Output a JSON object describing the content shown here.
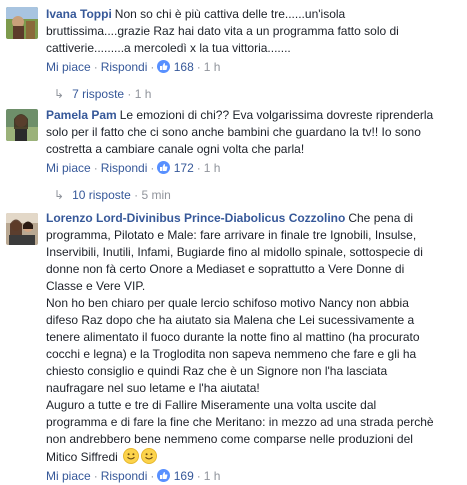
{
  "comments": [
    {
      "author": "Ivana Toppi",
      "text_lines": [
        "Non so chi è più cattiva delle tre......un'isola",
        "bruttissima....grazie Raz hai dato vita a un programma fatto solo di",
        "cattiverie.........a mercoledì x la tua vittoria......."
      ],
      "like_label": "Mi piace",
      "reply_label": "Rispondi",
      "like_count": "168",
      "time": "1 h",
      "replies_label": "7 risposte",
      "replies_time": "1 h"
    },
    {
      "author": "Pamela Pam",
      "text_lines": [
        "Le emozioni di chi?? Eva volgarissima dovreste riprenderla",
        "solo per il fatto che ci sono anche bambini che guardano la tv!! Io sono",
        "costretta a cambiare canale ogni volta che parla!"
      ],
      "like_label": "Mi piace",
      "reply_label": "Rispondi",
      "like_count": "172",
      "time": "1 h",
      "replies_label": "10 risposte",
      "replies_time": "5 min"
    },
    {
      "author": "Lorenzo Lord-Divinibus Prince-Diabolicus Cozzolino",
      "text_lines": [
        "Che pena di",
        "programma, Pilotato e Male: fare arrivare in finale tre Ignobili, Insulse,",
        "Inservibili, Inutili, Infami, Bugiarde fino al midollo spinale, sottospecie di",
        "donne non fà certo Onore a Mediaset e soprattutto a Vere Donne di",
        "Classe e Vere VIP.",
        "Non ho ben chiaro per quale lercio schifoso motivo Nancy non abbia",
        "difeso Raz dopo che ha aiutato sia Malena che Lei sucessivamente a",
        "tenere alimentato il fuoco durante la notte fino al mattino (ha procurato",
        "cocchi e legna) e la Troglodita non sapeva nemmeno che fare e gli ha",
        "chiesto consiglio e quindi Raz che è un Signore non l'ha lasciata",
        "naufragare nel suo letame e l'ha aiutata!",
        "Auguro a tutte e tre di Fallire Miseramente una volta uscite dal",
        "programma e di fare la fine che Meritano: in mezzo ad una strada perchè",
        "non andrebbero bene nemmeno come comparse nelle produzioni del",
        "Mitico Siffredi"
      ],
      "like_label": "Mi piace",
      "reply_label": "Rispondi",
      "like_count": "169",
      "time": "1 h"
    }
  ]
}
